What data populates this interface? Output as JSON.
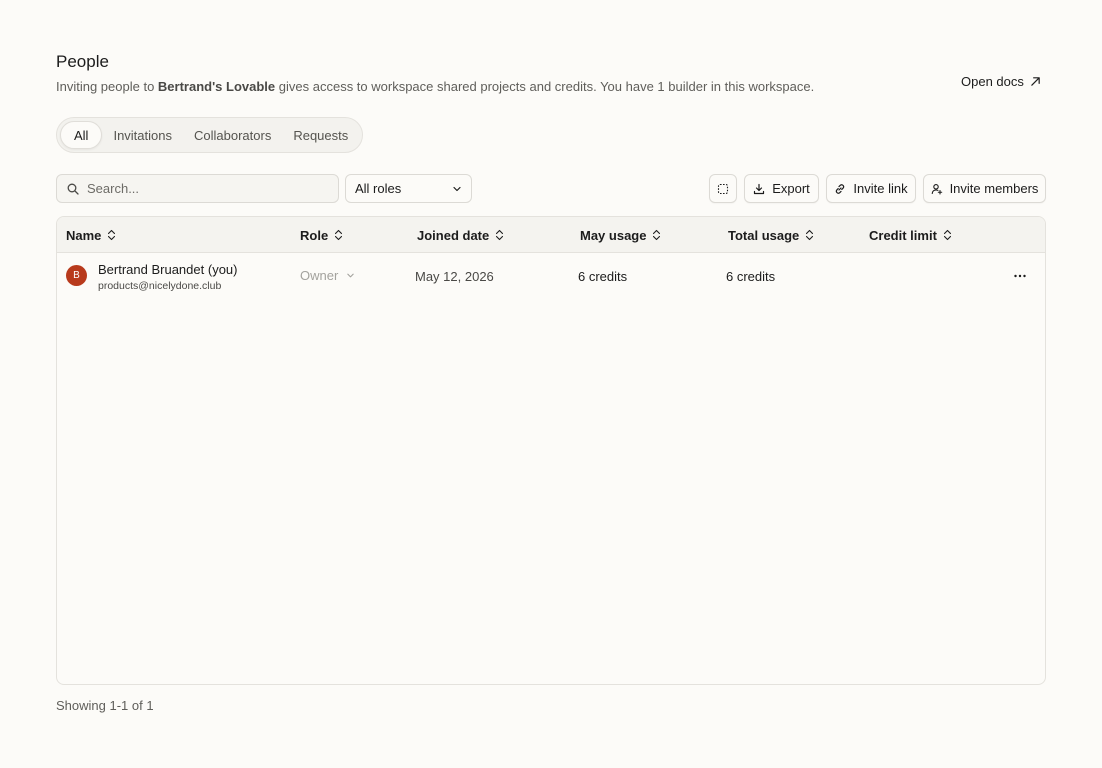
{
  "header": {
    "title": "People",
    "subtitle_prefix": "Inviting people to ",
    "workspace_name": "Bertrand's Lovable",
    "subtitle_suffix": " gives access to workspace shared projects and credits. You have 1 builder in this workspace.",
    "open_docs_label": "Open docs"
  },
  "tabs": [
    {
      "label": "All",
      "active": true
    },
    {
      "label": "Invitations",
      "active": false
    },
    {
      "label": "Collaborators",
      "active": false
    },
    {
      "label": "Requests",
      "active": false
    }
  ],
  "toolbar": {
    "search_placeholder": "Search...",
    "roles_filter": "All roles",
    "export_label": "Export",
    "invite_link_label": "Invite link",
    "invite_members_label": "Invite members"
  },
  "table": {
    "columns": [
      "Name",
      "Role",
      "Joined date",
      "May usage",
      "Total usage",
      "Credit limit"
    ],
    "rows": [
      {
        "avatar_initial": "B",
        "name": "Bertrand Bruandet",
        "you_tag": "(you)",
        "email": "products@nicelydone.club",
        "role": "Owner",
        "joined": "May 12, 2026",
        "may_usage": "6 credits",
        "total_usage": "6 credits",
        "credit_limit": ""
      }
    ]
  },
  "footer": {
    "pagination": "Showing 1-1 of 1"
  },
  "colors": {
    "background": "#fcfbf8",
    "avatar": "#b83a1c",
    "border": "#e4e2dd"
  }
}
